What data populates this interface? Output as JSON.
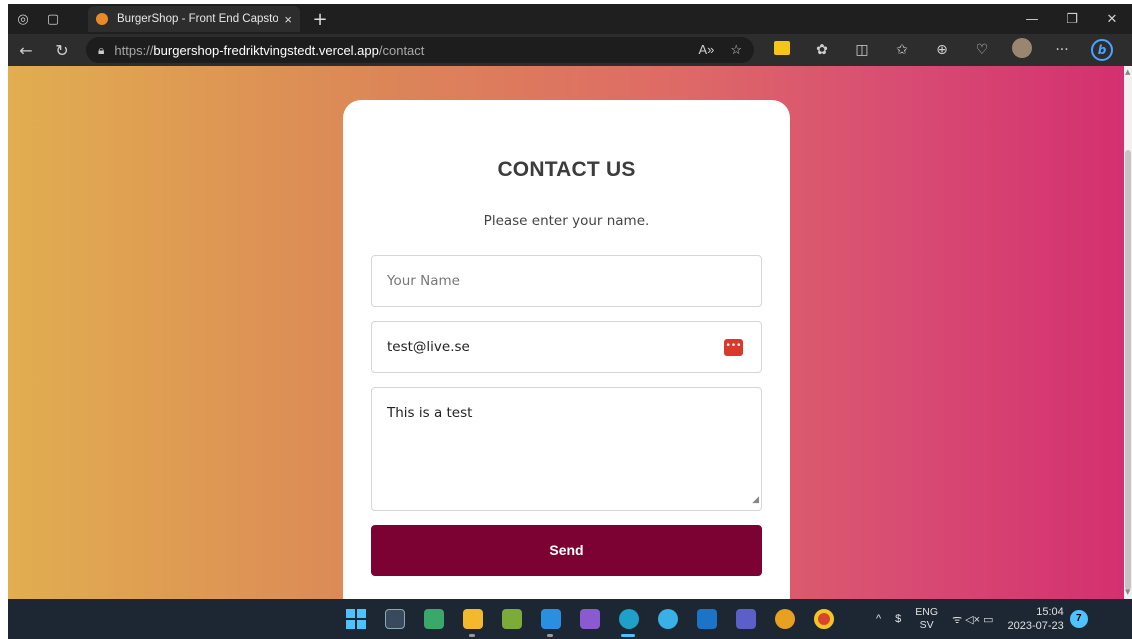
{
  "browser": {
    "tab": {
      "title": "BurgerShop - Front End Capstone",
      "close": "×"
    },
    "new_tab": "+",
    "window_controls": {
      "minimize": "—",
      "restore": "❐",
      "close": "✕"
    },
    "nav": {
      "back": "←",
      "refresh": "↻"
    },
    "url": {
      "protocol": "https://",
      "host": "burgershop-fredriktvingstedt.vercel.app",
      "path": "/contact"
    },
    "url_icons": {
      "read_aloud": "A»",
      "favorite": "☆"
    },
    "toolbar": {
      "split": "◫",
      "favorites": "✩",
      "collections": "⊕",
      "health": "♡",
      "more": "···"
    }
  },
  "contact": {
    "heading": "CONTACT US",
    "status": "Please enter your name.",
    "name_placeholder": "Your Name",
    "email_value": "test@live.se",
    "message_value": "This is a test",
    "send_label": "Send"
  },
  "taskbar": {
    "language": {
      "line1": "ENG",
      "line2": "SV"
    },
    "time": "15:04",
    "date": "2023-07-23",
    "notification_count": "7",
    "tray_chevron": "^",
    "tray_dollar": "$",
    "tray_status": "ᯤ ◁× ▭"
  },
  "colors": {
    "send_button": "#7c0233",
    "gradient_left": "#e1ae50",
    "gradient_right": "#d3306f"
  }
}
